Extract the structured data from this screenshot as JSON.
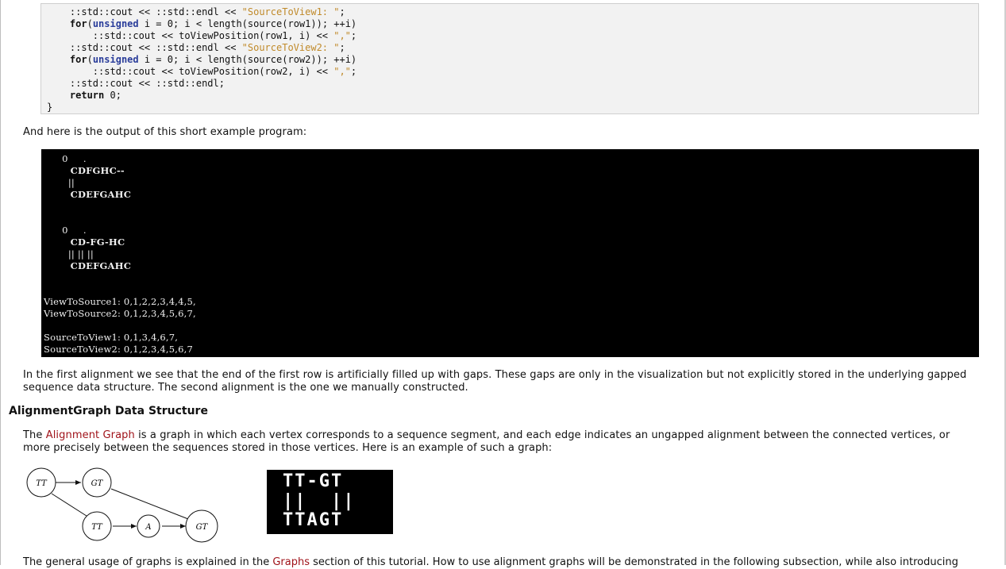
{
  "code": {
    "lines": [
      {
        "indent": "    ",
        "parts": [
          {
            "t": "::std::cout << ::std::endl << ",
            "c": ""
          },
          {
            "t": "\"SourceToView1: \"",
            "c": "str"
          },
          {
            "t": ";",
            "c": ""
          }
        ]
      },
      {
        "indent": "    ",
        "parts": [
          {
            "t": "for",
            "c": "kw"
          },
          {
            "t": "(",
            "c": ""
          },
          {
            "t": "unsigned",
            "c": "ty"
          },
          {
            "t": " i = 0; i < length(source(row1)); ++i)",
            "c": ""
          }
        ]
      },
      {
        "indent": "        ",
        "parts": [
          {
            "t": "::std::cout << toViewPosition(row1, i) << ",
            "c": ""
          },
          {
            "t": "\",\"",
            "c": "str"
          },
          {
            "t": ";",
            "c": ""
          }
        ]
      },
      {
        "indent": "    ",
        "parts": [
          {
            "t": "::std::cout << ::std::endl << ",
            "c": ""
          },
          {
            "t": "\"SourceToView2: \"",
            "c": "str"
          },
          {
            "t": ";",
            "c": ""
          }
        ]
      },
      {
        "indent": "    ",
        "parts": [
          {
            "t": "for",
            "c": "kw"
          },
          {
            "t": "(",
            "c": ""
          },
          {
            "t": "unsigned",
            "c": "ty"
          },
          {
            "t": " i = 0; i < length(source(row2)); ++i)",
            "c": ""
          }
        ]
      },
      {
        "indent": "        ",
        "parts": [
          {
            "t": "::std::cout << toViewPosition(row2, i) << ",
            "c": ""
          },
          {
            "t": "\",\"",
            "c": "str"
          },
          {
            "t": ";",
            "c": ""
          }
        ]
      },
      {
        "indent": "    ",
        "parts": [
          {
            "t": "::std::cout << ::std::endl;",
            "c": ""
          }
        ]
      },
      {
        "indent": "    ",
        "parts": [
          {
            "t": "return",
            "c": "kw"
          },
          {
            "t": " 0;",
            "c": ""
          }
        ]
      },
      {
        "indent": "",
        "parts": [
          {
            "t": "}",
            "c": ""
          }
        ]
      }
    ]
  },
  "intro_output": "And here is the output of this short example program:",
  "console": {
    "lines": [
      {
        "text": "      0     .",
        "bold": false
      },
      {
        "text": "        CDFGHC--",
        "bold": true
      },
      {
        "text": "        ||",
        "bold": false
      },
      {
        "text": "        CDEFGAHC",
        "bold": true
      },
      {
        "text": "",
        "bold": false
      },
      {
        "text": "",
        "bold": false
      },
      {
        "text": "      0     .",
        "bold": false
      },
      {
        "text": "        CD-FG-HC",
        "bold": true
      },
      {
        "text": "        || || ||",
        "bold": false
      },
      {
        "text": "        CDEFGAHC",
        "bold": true
      },
      {
        "text": "",
        "bold": false
      },
      {
        "text": "",
        "bold": false
      },
      {
        "text": "ViewToSource1: 0,1,2,2,3,4,4,5,",
        "bold": false
      },
      {
        "text": "ViewToSource2: 0,1,2,3,4,5,6,7,",
        "bold": false
      },
      {
        "text": "",
        "bold": false
      },
      {
        "text": "SourceToView1: 0,1,3,4,6,7,",
        "bold": false
      },
      {
        "text": "SourceToView2: 0,1,2,3,4,5,6,7",
        "bold": false
      }
    ]
  },
  "para_alignment_1": "In the first alignment we see that the end of the first row is artificially filled up with gaps. These gaps are only in the visualization but not explicitly stored in the underlying gapped",
  "para_alignment_2": "sequence data structure. The second alignment is the one we manually constructed.",
  "heading": "AlignmentGraph Data Structure",
  "para_graph": {
    "pre": "The ",
    "link": "Alignment Graph",
    "post": " is a graph in which each vertex corresponds to a sequence segment, and each edge indicates an ungapped alignment between the connected vertices, or",
    "line2": "more precisely between the sequences stored in those vertices. Here is an example of such a graph:"
  },
  "graph": {
    "nodes": [
      "TT",
      "GT",
      "TT",
      "A",
      "GT"
    ]
  },
  "alignment_image": {
    "line1": "TT-GT",
    "line2": "||  ||",
    "line3": "TTAGT"
  },
  "cut_para": {
    "pre": "The general usage of graphs is explained in the ",
    "link": "Graphs",
    "post": " section of this tutorial. How to use alignment graphs will be demonstrated in the following subsection, while also introducing"
  }
}
